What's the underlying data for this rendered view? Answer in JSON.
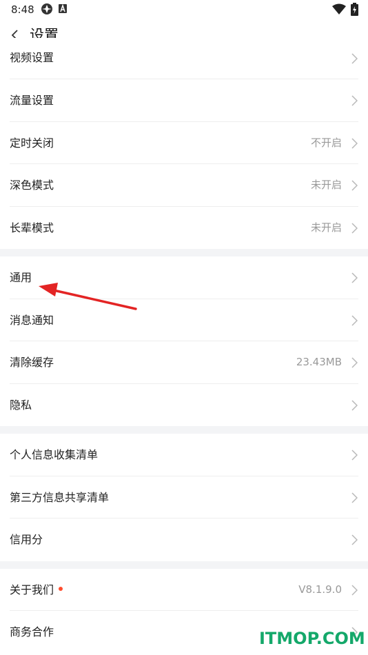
{
  "status_bar": {
    "time": "8:48"
  },
  "header": {
    "title": "设置"
  },
  "groups": [
    [
      {
        "label": "视频设置",
        "value": ""
      },
      {
        "label": "流量设置",
        "value": ""
      },
      {
        "label": "定时关闭",
        "value": "不开启"
      },
      {
        "label": "深色模式",
        "value": "未开启"
      },
      {
        "label": "长辈模式",
        "value": "未开启"
      }
    ],
    [
      {
        "label": "通用",
        "value": ""
      },
      {
        "label": "消息通知",
        "value": ""
      },
      {
        "label": "清除缓存",
        "value": "23.43MB"
      },
      {
        "label": "隐私",
        "value": ""
      }
    ],
    [
      {
        "label": "个人信息收集清单",
        "value": ""
      },
      {
        "label": "第三方信息共享清单",
        "value": ""
      },
      {
        "label": "信用分",
        "value": ""
      }
    ],
    [
      {
        "label": "关于我们",
        "value": "V8.1.9.0"
      },
      {
        "label": "商务合作",
        "value": ""
      }
    ]
  ],
  "watermark": "ITMOP.COM",
  "colors": {
    "arrow": "#e32424",
    "badge": "#ff4d2e",
    "watermark": "#14a86a",
    "value_text": "#999999"
  },
  "icons": [
    "status-app-icon",
    "status-a-icon",
    "wifi-icon",
    "battery-charging-icon",
    "back-arrow-icon",
    "chevron-right-icon",
    "annotation-arrow"
  ]
}
